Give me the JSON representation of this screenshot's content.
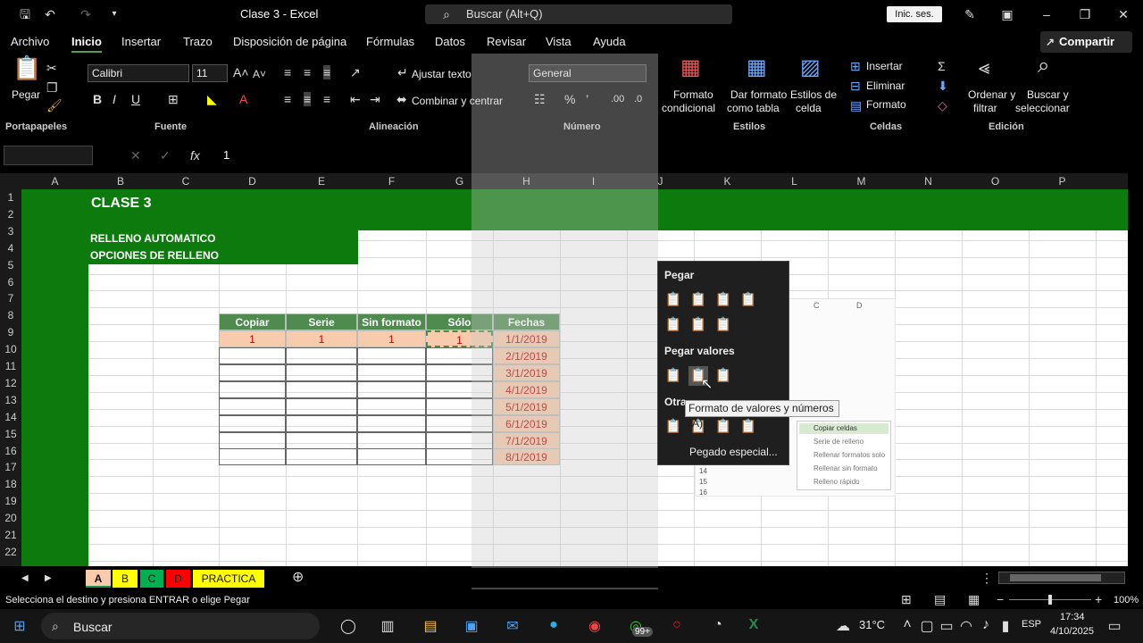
{
  "title_bar": {
    "doc_title": "Clase 3  -  Excel",
    "search_placeholder": "Buscar (Alt+Q)",
    "sign_in": "Inic. ses."
  },
  "ribbon_tabs": [
    "Archivo",
    "Inicio",
    "Insertar",
    "Trazo",
    "Disposición de página",
    "Fórmulas",
    "Datos",
    "Revisar",
    "Vista",
    "Ayuda"
  ],
  "share": "Compartir",
  "ribbon": {
    "paste": "Pegar",
    "font_name": "Calibri",
    "font_size": "11",
    "wrap_text": "Ajustar texto",
    "merge_center": "Combinar y centrar",
    "number_format": "General",
    "cond_format": [
      "Formato",
      "condicional"
    ],
    "format_table": [
      "Dar formato",
      "como tabla"
    ],
    "cell_styles": [
      "Estilos de",
      "celda"
    ],
    "insert": "Insertar",
    "delete": "Eliminar",
    "format": "Formato",
    "sort_filter": [
      "Ordenar y",
      "filtrar"
    ],
    "find_select": [
      "Buscar y",
      "seleccionar"
    ],
    "groups": [
      "Portapapeles",
      "Fuente",
      "Alineación",
      "Número",
      "Estilos",
      "Celdas",
      "Edición"
    ]
  },
  "formula_bar": {
    "value": "1"
  },
  "columns": [
    "A",
    "B",
    "C",
    "D",
    "E",
    "F",
    "G",
    "H",
    "I",
    "J",
    "K",
    "L",
    "M",
    "N",
    "O",
    "P"
  ],
  "rows": [
    "1",
    "2",
    "3",
    "4",
    "5",
    "6",
    "7",
    "8",
    "9",
    "10",
    "11",
    "12",
    "13",
    "14",
    "15",
    "16",
    "17",
    "18",
    "19",
    "20",
    "21",
    "22"
  ],
  "sheet_content": {
    "title": "CLASE 3",
    "subtitle1": "RELLENO AUTOMATICO",
    "subtitle2": "OPCIONES DE RELLENO",
    "table_headers": [
      "Copiar",
      "Serie",
      "Sin formato",
      "Sólo formato",
      "Fechas"
    ],
    "row9": [
      "1",
      "1",
      "1",
      "1",
      "1/1/2019"
    ],
    "dates": [
      "2/1/2019",
      "3/1/2019",
      "4/1/2019",
      "5/1/2019",
      "6/1/2019",
      "7/1/2019",
      "8/1/2019"
    ]
  },
  "paste_menu": {
    "heading_paste": "Pegar",
    "heading_values": "Pegar valores",
    "heading_other": "Otra",
    "special": "Pegado especial...",
    "tooltip": "Formato de valores y números (A)"
  },
  "embedded_image": {
    "cols": [
      "C",
      "D"
    ],
    "rows": [
      "14",
      "15",
      "16"
    ],
    "options": [
      "Copiar celdas",
      "Serie de relleno",
      "Rellenar formatos solo",
      "Rellenar sin formato",
      "Relleno rápido"
    ]
  },
  "sheet_tabs": [
    {
      "label": "A",
      "color": "#f8cbad"
    },
    {
      "label": "B",
      "color": "#ffff00"
    },
    {
      "label": "C",
      "color": "#00b050"
    },
    {
      "label": "D",
      "color": "#ff0000"
    },
    {
      "label": "PRACTICA",
      "color": "#ffff00"
    }
  ],
  "status": {
    "message": "Selecciona el destino y presiona ENTRAR o elige Pegar",
    "zoom": "100%"
  },
  "taskbar": {
    "search": "Buscar",
    "temp": "31°C",
    "lang": "ESP",
    "time": "17:34",
    "date": "4/10/2025",
    "badge": "99+"
  }
}
